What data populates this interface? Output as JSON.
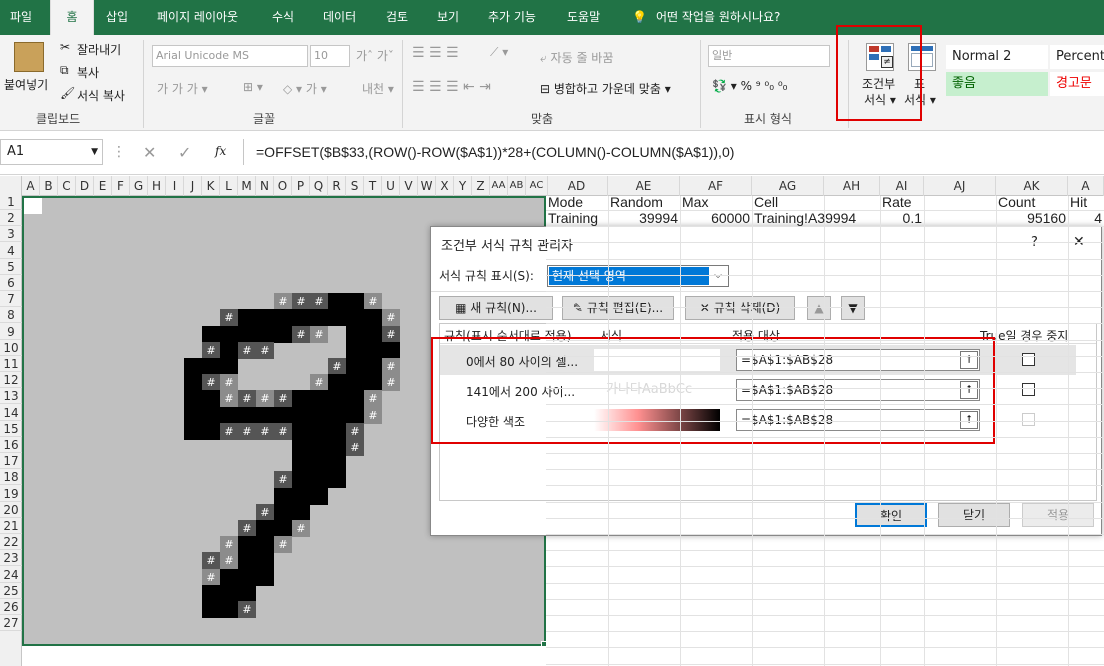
{
  "tabs": [
    "파일",
    "홈",
    "삽입",
    "페이지 레이아웃",
    "수식",
    "데이터",
    "검토",
    "보기",
    "추가 기능",
    "도움말",
    "어떤 작업을 원하시나요?"
  ],
  "ribbon": {
    "paste": "붙여넣기",
    "cut": "잘라내기",
    "copy": "복사",
    "format_painter": "서식 복사",
    "clipboard": "클립보드",
    "font_name": "Arial Unicode MS",
    "font_size": "10",
    "font_group": "글꼴",
    "wrap_text": "자동 줄 바꿈",
    "merge_center": "병합하고 가운데 맞춤",
    "align_group": "맞춤",
    "number_format": "일반",
    "number_group": "표시 형식",
    "cond_format": [
      "조건부",
      "서식"
    ],
    "table_format": [
      "표",
      "서식"
    ],
    "styles": [
      "Normal 2",
      "Percent",
      "좋음",
      "경고문"
    ]
  },
  "formula_bar": {
    "name_box": "A1",
    "fx": "fx",
    "formula": "=OFFSET($B$33,(ROW()-ROW($A$1))*28+(COLUMN()-COLUMN($A$1)),0)"
  },
  "columns_left": [
    "A",
    "B",
    "C",
    "D",
    "E",
    "F",
    "G",
    "H",
    "I",
    "J",
    "K",
    "L",
    "M",
    "N",
    "O",
    "P",
    "Q",
    "R",
    "S",
    "T",
    "U",
    "V",
    "W",
    "X",
    "Y",
    "Z",
    "AA",
    "AB",
    "AC"
  ],
  "columns_right": [
    "AD",
    "AE",
    "AF",
    "AG",
    "AH",
    "AI",
    "AJ",
    "AK",
    "A"
  ],
  "rows": [
    "1",
    "2",
    "3",
    "4",
    "5",
    "6",
    "7",
    "8",
    "9",
    "10",
    "11",
    "12",
    "13",
    "14",
    "15",
    "16",
    "17",
    "18",
    "19",
    "20",
    "21",
    "22",
    "23",
    "24",
    "25",
    "26",
    "27"
  ],
  "sheet_row1": [
    "Mode",
    "Random",
    "Max",
    "Cell",
    "",
    "Rate",
    "",
    "Count",
    "Hit"
  ],
  "sheet_row2": [
    "Training",
    "39994",
    "60000",
    "Training!A39994",
    "",
    "0.1",
    "",
    "95160",
    "4"
  ],
  "pixel_mark": "#",
  "dialog": {
    "title": "조건부 서식 규칙 관리자",
    "help": "?",
    "close": "✕",
    "show_rules_label": "서식 규칙 표시(S):",
    "show_rules_value": "현재 선택 영역",
    "new_rule": "새 규칙(N)...",
    "edit_rule": "규칙 편집(E)...",
    "delete_rule": "규칙 삭제(D)",
    "headers": [
      "규칙(표시 순서대로 적용)",
      "서식",
      "적용 대상",
      "True일 경우 중지"
    ],
    "rules": [
      {
        "name": "0에서 80 사이의 셀...",
        "preview": "",
        "range": "=$A$1:$AB$28"
      },
      {
        "name": "141에서 200 사이...",
        "preview": "가나다AaBbCc",
        "range": "=$A$1:$AB$28"
      },
      {
        "name": "다양한 색조",
        "preview": "",
        "range": "=$A$1:$AB$28"
      }
    ],
    "ok": "확인",
    "close_btn": "닫기",
    "apply": "적용"
  }
}
